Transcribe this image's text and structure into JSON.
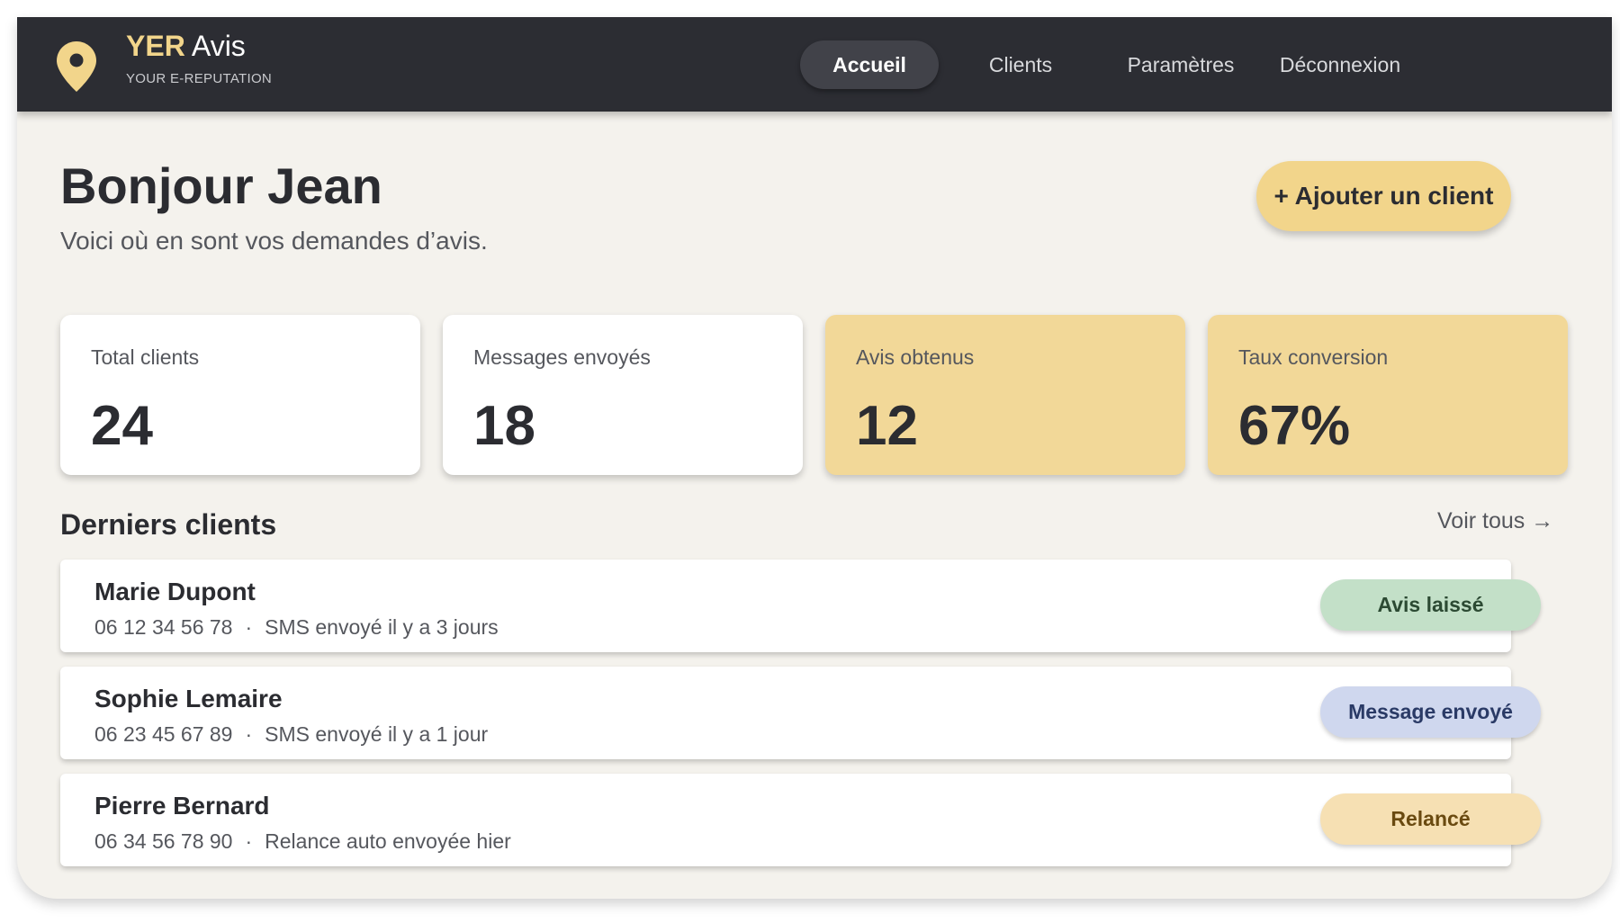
{
  "brand": {
    "name_accent": "YER",
    "name_rest": " Avis",
    "tagline": "YOUR E-REPUTATION",
    "logo_icon": "map-pin-icon"
  },
  "nav": {
    "items": [
      {
        "label": "Accueil",
        "active": true
      },
      {
        "label": "Clients",
        "active": false
      },
      {
        "label": "Paramètres",
        "active": false
      },
      {
        "label": "Déconnexion",
        "active": false
      }
    ]
  },
  "header": {
    "title": "Bonjour Jean",
    "subtitle": "Voici où en sont vos demandes d’avis.",
    "add_button_label": "+ Ajouter un client"
  },
  "stats": [
    {
      "label": "Total clients",
      "value": "24"
    },
    {
      "label": "Messages envoyés",
      "value": "18"
    },
    {
      "label": "Avis obtenus",
      "value": "12"
    },
    {
      "label": "Taux conversion",
      "value": "67%"
    }
  ],
  "recent_clients": {
    "title": "Derniers clients",
    "see_all_label": "Voir tous →",
    "separator": "·",
    "rows": [
      {
        "name": "Marie Dupont",
        "phone": "06 12 34 56 78",
        "activity": "SMS envoyé il y a 3 jours",
        "status": "Avis laissé"
      },
      {
        "name": "Sophie Lemaire",
        "phone": "06 23 45 67 89",
        "activity": "SMS envoyé il y a 1 jour",
        "status": "Message envoyé"
      },
      {
        "name": "Pierre Bernard",
        "phone": "06 34 56 78 90",
        "activity": "Relance auto envoyée hier",
        "status": "Relancé"
      }
    ]
  },
  "colors": {
    "topbar": "#2c2d33",
    "accent": "#f2d58b",
    "page_bg": "#f4f2ed",
    "status_review_bg": "#c3e0c8",
    "status_review_text": "#2c4a33",
    "status_sent_bg": "#cfd7ee",
    "status_sent_text": "#2a3a66",
    "status_relaunch_bg": "#f6e0b3",
    "status_relaunch_text": "#6a4a10"
  }
}
